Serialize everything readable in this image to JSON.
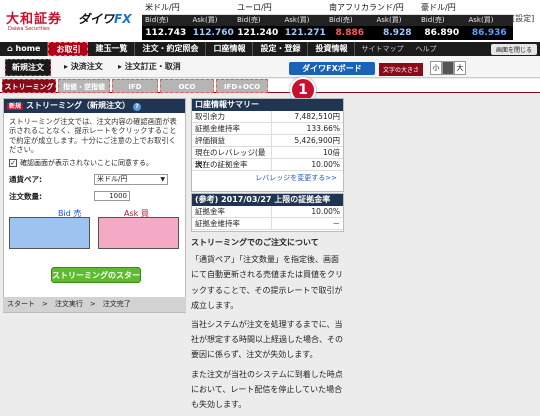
{
  "header": {
    "logo_main": "大和証券",
    "logo_sub": "Daiwa Securities",
    "logo_fx_prefix": "ダイワ",
    "logo_fx_suffix": "FX",
    "settings_label": "[設定]"
  },
  "rates": [
    {
      "pair": "米ドル/円",
      "bid_label": "Bid(売)",
      "ask_label": "Ask(買)",
      "bid": "112.743",
      "ask": "112.760"
    },
    {
      "pair": "ユーロ/円",
      "bid_label": "Bid(売)",
      "ask_label": "Ask(買)",
      "bid": "121.240",
      "ask": "121.271"
    },
    {
      "pair": "南アフリカランド/円",
      "bid_label": "Bid(売)",
      "ask_label": "Ask(買)",
      "bid": "8.886",
      "ask": "8.928"
    },
    {
      "pair": "豪ドル/円",
      "bid_label": "Bid(売)",
      "ask_label": "Ask(買)",
      "bid": "86.890",
      "ask": "86.936"
    }
  ],
  "nav": {
    "items": [
      "⌂ home",
      "お取引",
      "建玉一覧",
      "注文・約定照会",
      "口座情報",
      "設定・登録",
      "投資情報"
    ],
    "site_map": "サイトマップ",
    "help": "ヘルプ",
    "close_button": "画面を閉じる"
  },
  "subnav": {
    "new_order": "新規注文",
    "settlement": "▸ 決済注文",
    "modify": "▸ 注文訂正・取消",
    "fx_board": "ダイワFXボード",
    "font_size_label": "文字の大きさ",
    "font_small": "小",
    "font_large": "大"
  },
  "tabs": [
    "ストリーミング",
    "指値・逆指値",
    "IFD",
    "OCO",
    "IFD+OCO"
  ],
  "badge": "1",
  "left": {
    "new_badge": "新規",
    "title": "ストリーミング（新規注文）",
    "description": "ストリーミング注文では、注文内容の確認画面が表示されることなく、提示レートをクリックすることで約定が成立します。十分にご注意の上でお取引ください。",
    "checkbox_label": "確認画面が表示されないことに同意する。",
    "pair_label": "通貨ペア:",
    "pair_value": "米ドル/円",
    "qty_label": "注文数量:",
    "qty_value": "1000",
    "bid_label": "Bid 売",
    "ask_label": "Ask 買",
    "start_button": "ストリーミングのスタート",
    "status": "スタート　>　注文実行　>　注文完了"
  },
  "summary": {
    "title": "口座情報サマリー",
    "rows": [
      {
        "k": "取引余力",
        "v": "7,482,510円"
      },
      {
        "k": "証拠金維持率",
        "v": "133.66%"
      },
      {
        "k": "評価損益",
        "v": "5,426,900円"
      },
      {
        "k": "現在のレバレッジ(最大)",
        "v": "10倍"
      },
      {
        "k": "現在の証拠金率",
        "v": "10.00%"
      }
    ],
    "leverage_link": "レバレッジを変更する>>",
    "ref_title": "(参考) 2017/03/27 上限の証拠金率",
    "ref_rows": [
      {
        "k": "証拠金率",
        "v": "10.00%"
      },
      {
        "k": "証拠金維持率",
        "v": "－"
      }
    ]
  },
  "notice": {
    "title": "ストリーミングでのご注文について",
    "p1": "「通貨ペア」「注文数量」を指定後、画面にて自動更新される売値または買値をクリックすることで、その提示レートで取引が成立します。",
    "p2": "当社システムが注文を処理するまでに、当社が想定する時間以上経過した場合、その要因に係らず、注文が失効します。",
    "p3": "また注文が当社のシステムに到着した時点において、レート配信を停止していた場合も失効します。"
  }
}
